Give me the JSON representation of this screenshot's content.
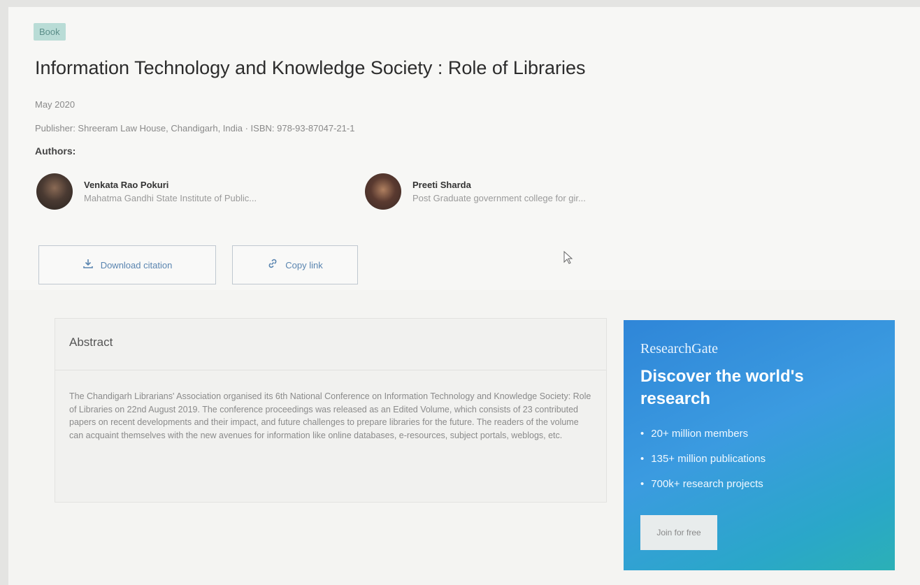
{
  "publication": {
    "type_badge": "Book",
    "title": "Information Technology and Knowledge Society : Role of Libraries",
    "date": "May 2020",
    "publisher_line": "Publisher: Shreeram Law House, Chandigarh, India · ISBN: 978-93-87047-21-1",
    "authors_label": "Authors:",
    "authors": [
      {
        "name": "Venkata Rao Pokuri",
        "affiliation": "Mahatma Gandhi State Institute of Public..."
      },
      {
        "name": "Preeti Sharda",
        "affiliation": "Post Graduate government college for gir..."
      }
    ]
  },
  "actions": {
    "download_citation": "Download citation",
    "copy_link": "Copy link",
    "download_icon": "download-icon",
    "link_icon": "link-icon"
  },
  "abstract": {
    "heading": "Abstract",
    "text": "The Chandigarh Librarians' Association organised its 6th National Conference on Information Technology and Knowledge Society: Role of Libraries on 22nd August 2019. The conference proceedings was released as an Edited Volume, which consists of 23 contributed papers on recent developments and their impact, and future challenges to prepare libraries for the future. The readers of the volume can acquaint themselves with the new avenues for information like online databases, e-resources, subject portals, weblogs, etc."
  },
  "promo": {
    "brand": "ResearchGate",
    "headline": "Discover the world's research",
    "stats": [
      "20+ million members",
      "135+ million publications",
      "700k+ research projects"
    ],
    "join_label": "Join for free",
    "colors": {
      "gradient_start": "#2f86d8",
      "gradient_end": "#2bb0b6"
    }
  }
}
